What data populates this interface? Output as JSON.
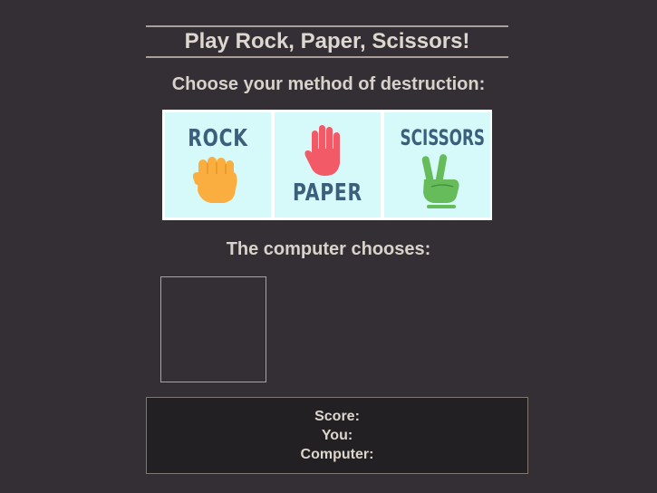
{
  "header": {
    "title": "Play Rock, Paper, Scissors!"
  },
  "choose": {
    "heading": "Choose your method of destruction:",
    "options": [
      {
        "label": "ROCK",
        "icon": "fist-icon",
        "color": "#f9ae3f"
      },
      {
        "label": "PAPER",
        "icon": "open-hand-icon",
        "color": "#f35a68"
      },
      {
        "label": "SCISSORS",
        "icon": "peace-hand-icon",
        "color": "#66bb5a"
      }
    ]
  },
  "computer": {
    "heading": "The computer chooses:"
  },
  "score": {
    "score_label": "Score:",
    "you_label": "You:",
    "computer_label": "Computer:"
  },
  "colors": {
    "background": "#332f34",
    "label_blue": "#3b5f7c",
    "tile_bg": "#d6fafa"
  }
}
